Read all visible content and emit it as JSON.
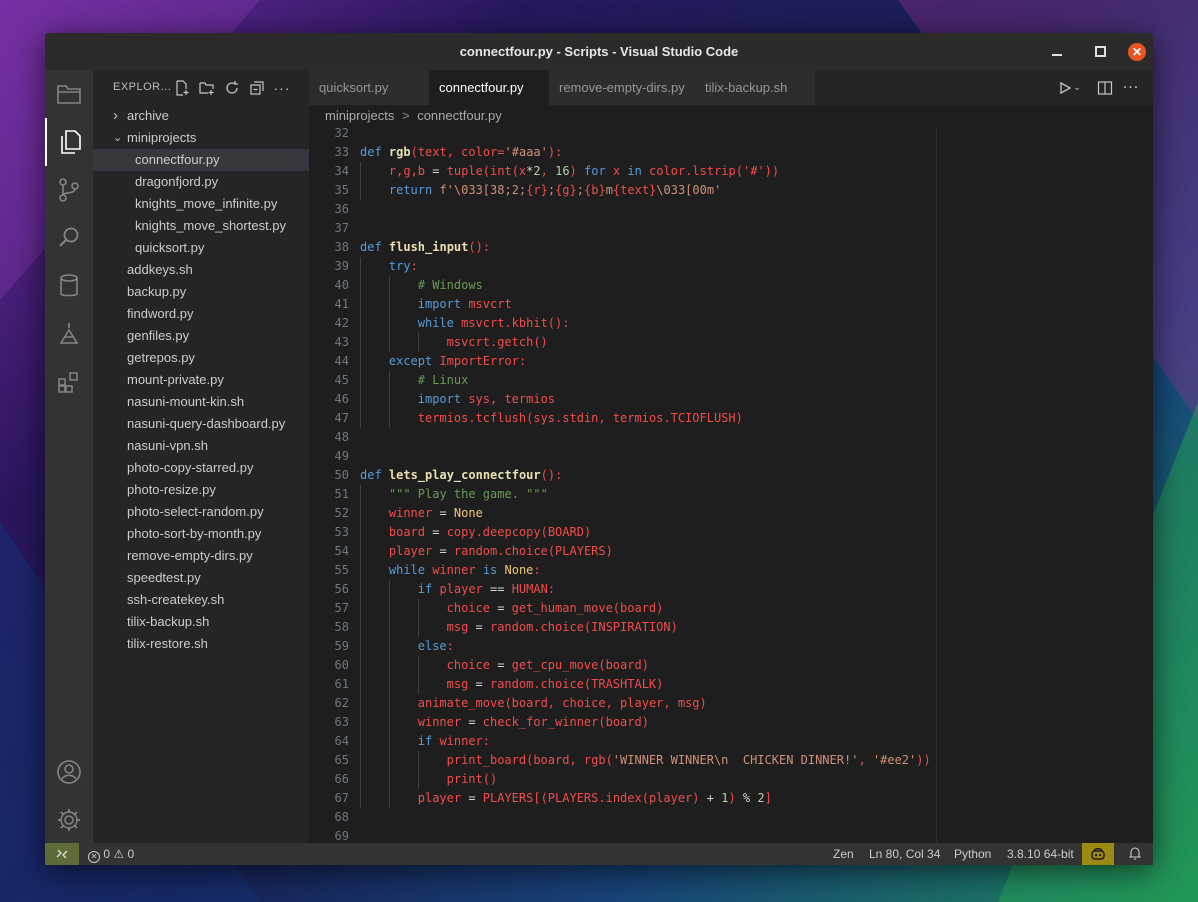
{
  "window": {
    "title": "connectfour.py - Scripts - Visual Studio Code"
  },
  "explorer": {
    "title": "EXPLOR...",
    "tree": [
      {
        "label": "archive",
        "type": "folder",
        "depth": 0,
        "expanded": false
      },
      {
        "label": "miniprojects",
        "type": "folder",
        "depth": 0,
        "expanded": true
      },
      {
        "label": "connectfour.py",
        "type": "file",
        "depth": 1,
        "selected": true
      },
      {
        "label": "dragonfjord.py",
        "type": "file",
        "depth": 1
      },
      {
        "label": "knights_move_infinite.py",
        "type": "file",
        "depth": 1
      },
      {
        "label": "knights_move_shortest.py",
        "type": "file",
        "depth": 1
      },
      {
        "label": "quicksort.py",
        "type": "file",
        "depth": 1
      },
      {
        "label": "addkeys.sh",
        "type": "file",
        "depth": 0
      },
      {
        "label": "backup.py",
        "type": "file",
        "depth": 0
      },
      {
        "label": "findword.py",
        "type": "file",
        "depth": 0
      },
      {
        "label": "genfiles.py",
        "type": "file",
        "depth": 0
      },
      {
        "label": "getrepos.py",
        "type": "file",
        "depth": 0
      },
      {
        "label": "mount-private.py",
        "type": "file",
        "depth": 0
      },
      {
        "label": "nasuni-mount-kin.sh",
        "type": "file",
        "depth": 0
      },
      {
        "label": "nasuni-query-dashboard.py",
        "type": "file",
        "depth": 0
      },
      {
        "label": "nasuni-vpn.sh",
        "type": "file",
        "depth": 0
      },
      {
        "label": "photo-copy-starred.py",
        "type": "file",
        "depth": 0
      },
      {
        "label": "photo-resize.py",
        "type": "file",
        "depth": 0
      },
      {
        "label": "photo-select-random.py",
        "type": "file",
        "depth": 0
      },
      {
        "label": "photo-sort-by-month.py",
        "type": "file",
        "depth": 0
      },
      {
        "label": "remove-empty-dirs.py",
        "type": "file",
        "depth": 0
      },
      {
        "label": "speedtest.py",
        "type": "file",
        "depth": 0
      },
      {
        "label": "ssh-createkey.sh",
        "type": "file",
        "depth": 0
      },
      {
        "label": "tilix-backup.sh",
        "type": "file",
        "depth": 0
      },
      {
        "label": "tilix-restore.sh",
        "type": "file",
        "depth": 0
      }
    ]
  },
  "tabs": [
    {
      "label": "quicksort.py",
      "active": false
    },
    {
      "label": "connectfour.py",
      "active": true
    },
    {
      "label": "remove-empty-dirs.py",
      "active": false
    },
    {
      "label": "tilix-backup.sh",
      "active": false
    }
  ],
  "breadcrumb": {
    "folder": "miniprojects",
    "separator": ">",
    "file": "connectfour.py"
  },
  "colors": {
    "keyword": "#569cd6",
    "function": "#e8e0b0",
    "call": "#f14c4c",
    "string": "#ce9178",
    "comment": "#6a9955",
    "number": "#b5cea8",
    "constant": "#f0c674",
    "plain": "#d4d4d4",
    "punct": "#f14c4c"
  },
  "code": [
    {
      "n": "32",
      "indent": 0,
      "tokens": []
    },
    {
      "n": "33",
      "indent": 0,
      "tokens": [
        [
          "k",
          "def "
        ],
        [
          "f",
          "rgb"
        ],
        [
          "p",
          "(text, color="
        ],
        [
          "s",
          "'#aaa'"
        ],
        [
          "p",
          "):"
        ]
      ]
    },
    {
      "n": "34",
      "indent": 1,
      "tokens": [
        [
          "c",
          "r,g,b "
        ],
        [
          "x",
          "= "
        ],
        [
          "c",
          "tuple(int(x"
        ],
        [
          "x",
          "*"
        ],
        [
          "n",
          "2"
        ],
        [
          "c",
          ", "
        ],
        [
          "n",
          "16"
        ],
        [
          "c",
          ") "
        ],
        [
          "k",
          "for "
        ],
        [
          "c",
          "x "
        ],
        [
          "k",
          "in "
        ],
        [
          "c",
          "color.lstrip('#'))"
        ]
      ]
    },
    {
      "n": "35",
      "indent": 1,
      "tokens": [
        [
          "k",
          "return "
        ],
        [
          "s",
          "f'\\033[38;2;"
        ],
        [
          "c",
          "{r}"
        ],
        [
          "s",
          ";"
        ],
        [
          "c",
          "{g}"
        ],
        [
          "s",
          ";"
        ],
        [
          "c",
          "{b}"
        ],
        [
          "s",
          "m"
        ],
        [
          "c",
          "{text}"
        ],
        [
          "s",
          "\\033[00m'"
        ]
      ]
    },
    {
      "n": "36",
      "indent": 0,
      "tokens": []
    },
    {
      "n": "37",
      "indent": 0,
      "tokens": []
    },
    {
      "n": "38",
      "indent": 0,
      "tokens": [
        [
          "k",
          "def "
        ],
        [
          "f",
          "flush_input"
        ],
        [
          "p",
          "():"
        ]
      ]
    },
    {
      "n": "39",
      "indent": 1,
      "tokens": [
        [
          "k",
          "try"
        ],
        [
          "p",
          ":"
        ]
      ]
    },
    {
      "n": "40",
      "indent": 2,
      "tokens": [
        [
          "m",
          "# Windows"
        ]
      ]
    },
    {
      "n": "41",
      "indent": 2,
      "tokens": [
        [
          "k",
          "import "
        ],
        [
          "c",
          "msvcrt"
        ]
      ]
    },
    {
      "n": "42",
      "indent": 2,
      "tokens": [
        [
          "k",
          "while "
        ],
        [
          "c",
          "msvcrt.kbhit():"
        ]
      ]
    },
    {
      "n": "43",
      "indent": 3,
      "tokens": [
        [
          "c",
          "msvcrt.getch()"
        ]
      ]
    },
    {
      "n": "44",
      "indent": 1,
      "tokens": [
        [
          "k",
          "except "
        ],
        [
          "c",
          "ImportError"
        ],
        [
          "p",
          ":"
        ]
      ]
    },
    {
      "n": "45",
      "indent": 2,
      "tokens": [
        [
          "m",
          "# Linux"
        ]
      ]
    },
    {
      "n": "46",
      "indent": 2,
      "tokens": [
        [
          "k",
          "import "
        ],
        [
          "c",
          "sys, termios"
        ]
      ]
    },
    {
      "n": "47",
      "indent": 2,
      "tokens": [
        [
          "c",
          "termios.tcflush(sys.stdin, termios.TCIOFLUSH)"
        ]
      ]
    },
    {
      "n": "48",
      "indent": 0,
      "tokens": []
    },
    {
      "n": "49",
      "indent": 0,
      "tokens": []
    },
    {
      "n": "50",
      "indent": 0,
      "tokens": [
        [
          "k",
          "def "
        ],
        [
          "f",
          "lets_play_connectfour"
        ],
        [
          "p",
          "():"
        ]
      ]
    },
    {
      "n": "51",
      "indent": 1,
      "tokens": [
        [
          "m",
          "\"\"\" Play the game. \"\"\""
        ]
      ]
    },
    {
      "n": "52",
      "indent": 1,
      "tokens": [
        [
          "c",
          "winner "
        ],
        [
          "x",
          "= "
        ],
        [
          "o",
          "None"
        ]
      ]
    },
    {
      "n": "53",
      "indent": 1,
      "tokens": [
        [
          "c",
          "board "
        ],
        [
          "x",
          "= "
        ],
        [
          "c",
          "copy.deepcopy(BOARD)"
        ]
      ]
    },
    {
      "n": "54",
      "indent": 1,
      "tokens": [
        [
          "c",
          "player "
        ],
        [
          "x",
          "= "
        ],
        [
          "c",
          "random.choice(PLAYERS)"
        ]
      ]
    },
    {
      "n": "55",
      "indent": 1,
      "tokens": [
        [
          "k",
          "while "
        ],
        [
          "c",
          "winner "
        ],
        [
          "k",
          "is "
        ],
        [
          "o",
          "None"
        ],
        [
          "p",
          ":"
        ]
      ]
    },
    {
      "n": "56",
      "indent": 2,
      "tokens": [
        [
          "k",
          "if "
        ],
        [
          "c",
          "player "
        ],
        [
          "x",
          "== "
        ],
        [
          "c",
          "HUMAN"
        ],
        [
          "p",
          ":"
        ]
      ]
    },
    {
      "n": "57",
      "indent": 3,
      "tokens": [
        [
          "c",
          "choice "
        ],
        [
          "x",
          "= "
        ],
        [
          "c",
          "get_human_move(board)"
        ]
      ]
    },
    {
      "n": "58",
      "indent": 3,
      "tokens": [
        [
          "c",
          "msg "
        ],
        [
          "x",
          "= "
        ],
        [
          "c",
          "random.choice(INSPIRATION)"
        ]
      ]
    },
    {
      "n": "59",
      "indent": 2,
      "tokens": [
        [
          "k",
          "else"
        ],
        [
          "p",
          ":"
        ]
      ]
    },
    {
      "n": "60",
      "indent": 3,
      "tokens": [
        [
          "c",
          "choice "
        ],
        [
          "x",
          "= "
        ],
        [
          "c",
          "get_cpu_move(board)"
        ]
      ]
    },
    {
      "n": "61",
      "indent": 3,
      "tokens": [
        [
          "c",
          "msg "
        ],
        [
          "x",
          "= "
        ],
        [
          "c",
          "random.choice(TRASHTALK)"
        ]
      ]
    },
    {
      "n": "62",
      "indent": 2,
      "tokens": [
        [
          "c",
          "animate_move(board, choice, player, msg)"
        ]
      ]
    },
    {
      "n": "63",
      "indent": 2,
      "tokens": [
        [
          "c",
          "winner "
        ],
        [
          "x",
          "= "
        ],
        [
          "c",
          "check_for_winner(board)"
        ]
      ]
    },
    {
      "n": "64",
      "indent": 2,
      "tokens": [
        [
          "k",
          "if "
        ],
        [
          "c",
          "winner"
        ],
        [
          "p",
          ":"
        ]
      ]
    },
    {
      "n": "65",
      "indent": 3,
      "tokens": [
        [
          "c",
          "print_board(board, rgb("
        ],
        [
          "s",
          "'WINNER WINNER\\n  CHICKEN DINNER!'"
        ],
        [
          "p",
          ", "
        ],
        [
          "s",
          "'#ee2'"
        ],
        [
          "c",
          "))"
        ]
      ]
    },
    {
      "n": "66",
      "indent": 3,
      "tokens": [
        [
          "c",
          "print()"
        ]
      ]
    },
    {
      "n": "67",
      "indent": 2,
      "tokens": [
        [
          "c",
          "player "
        ],
        [
          "x",
          "= "
        ],
        [
          "c",
          "PLAYERS[(PLAYERS.index(player) "
        ],
        [
          "x",
          "+ "
        ],
        [
          "n",
          "1"
        ],
        [
          "c",
          ") "
        ],
        [
          "x",
          "% "
        ],
        [
          "n",
          "2"
        ],
        [
          "c",
          "]"
        ]
      ]
    },
    {
      "n": "68",
      "indent": 0,
      "tokens": []
    },
    {
      "n": "69",
      "indent": 0,
      "tokens": []
    }
  ],
  "status": {
    "errors": "0",
    "warnings": "0",
    "zen": "Zen",
    "position": "Ln 80, Col 34",
    "language": "Python",
    "interpreter": "3.8.10 64-bit"
  }
}
